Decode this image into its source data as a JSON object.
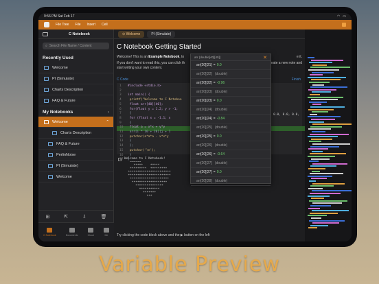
{
  "status": {
    "time": "9:56 PM",
    "date": "Sat Feb 17"
  },
  "menubar": {
    "items": [
      "File Tree",
      "File",
      "Insert",
      "Cell"
    ]
  },
  "sidebar": {
    "title": "C Notebook",
    "search_placeholder": "Search File Name / Content",
    "recent_header": "Recently Used",
    "recent": [
      "Welcome",
      "PI (Simulate)",
      "Charts Description",
      "FAQ & Future"
    ],
    "notebooks_header": "My Notebooks",
    "notebooks": [
      "Welcome",
      "Charts Description",
      "FAQ & Future",
      "PerlinNoise",
      "PI (Simulate)",
      "Welcome"
    ],
    "tabs": [
      "C Notebook",
      "Documents",
      "Cloud",
      "Me"
    ]
  },
  "main": {
    "tabs": [
      "Welcome",
      "PI (Simulate)"
    ],
    "heading": "C Notebook Getting Started",
    "p1_a": "Welcome! This is an",
    "p1_b": "Example Notebook",
    "p1_c": ", to",
    "p1_tail": "e it.",
    "p2_a": "If you don't want to read this, you can click th",
    "p2_b": "start writing your own content.",
    "p2_tail": "create a new note and",
    "code_label": "C Code",
    "code_right": "Finish",
    "code_lines": [
      {
        "n": "1",
        "t": "#include <stdio.h>"
      },
      {
        "n": "2",
        "t": ""
      },
      {
        "n": "3",
        "t": "int main() {"
      },
      {
        "n": "4",
        "t": "    printf(\"Welcome to C Noteboo"
      },
      {
        "n": "5",
        "t": "    float arr[40][40];"
      },
      {
        "n": "6",
        "t": "    for(float y = 1.2; y > -1;"
      },
      {
        "n": "7",
        "t": "    {"
      },
      {
        "n": "8",
        "t": "        for (float x = -1.1; x"
      },
      {
        "n": "9",
        "t": "        {"
      },
      {
        "n": "10",
        "t": "            float a = x*x + y*y"
      },
      {
        "n": "11",
        "t": "            arr[i * 10 + 20][j + 1"
      },
      {
        "n": "12",
        "t": "            putchar(a*a*a - x*x*y"
      },
      {
        "n": "13",
        "t": "        }"
      },
      {
        "n": "14",
        "t": "    };"
      },
      {
        "n": "15",
        "t": "    putchar('\\n');"
      },
      {
        "n": "16",
        "t": "    }"
      },
      {
        "n": "17",
        "t": "}"
      }
    ],
    "code_side": "0.0, 0.0, 0.0,",
    "output": "Welcome to C Notebook!\n   ~~~~~~\n     *****    *****\n   *********  *********\n  ***********************\n  ***********************\n   *********************\n    *******************\n      ***************\n        ***********\n          *******\n            ***",
    "footnote": "Try clicking the code block above and the ▶ button on the left"
  },
  "popup": {
    "title": "arr (double[40][40])",
    "rows": [
      {
        "k": "arr[20][21]",
        "v": "0.0",
        "t": false
      },
      {
        "k": "arr[20][22]",
        "v": "(double)",
        "t": true
      },
      {
        "k": "arr[20][22]",
        "v": "-0.96",
        "t": false
      },
      {
        "k": "arr[20][23]",
        "v": "(double)",
        "t": true
      },
      {
        "k": "arr[20][23]",
        "v": "0.0",
        "t": false
      },
      {
        "k": "arr[20][24]",
        "v": "(double)",
        "t": true
      },
      {
        "k": "arr[20][24]",
        "v": "-0.84",
        "t": false
      },
      {
        "k": "arr[20][25]",
        "v": "(double)",
        "t": true
      },
      {
        "k": "arr[20][25]",
        "v": "0.0",
        "t": false
      },
      {
        "k": "arr[20][26]",
        "v": "(double)",
        "t": true
      },
      {
        "k": "arr[20][26]",
        "v": "-0.64",
        "t": false
      },
      {
        "k": "arr[20][27]",
        "v": "(double)",
        "t": true
      },
      {
        "k": "arr[20][27]",
        "v": "0.0",
        "t": false
      },
      {
        "k": "arr[20][28]",
        "v": "(double)",
        "t": true
      }
    ]
  },
  "caption": "Variable Preview",
  "colors": {
    "accent": "#c46f1c",
    "caption": "#e6a94b",
    "value_green": "#6fd36f"
  }
}
